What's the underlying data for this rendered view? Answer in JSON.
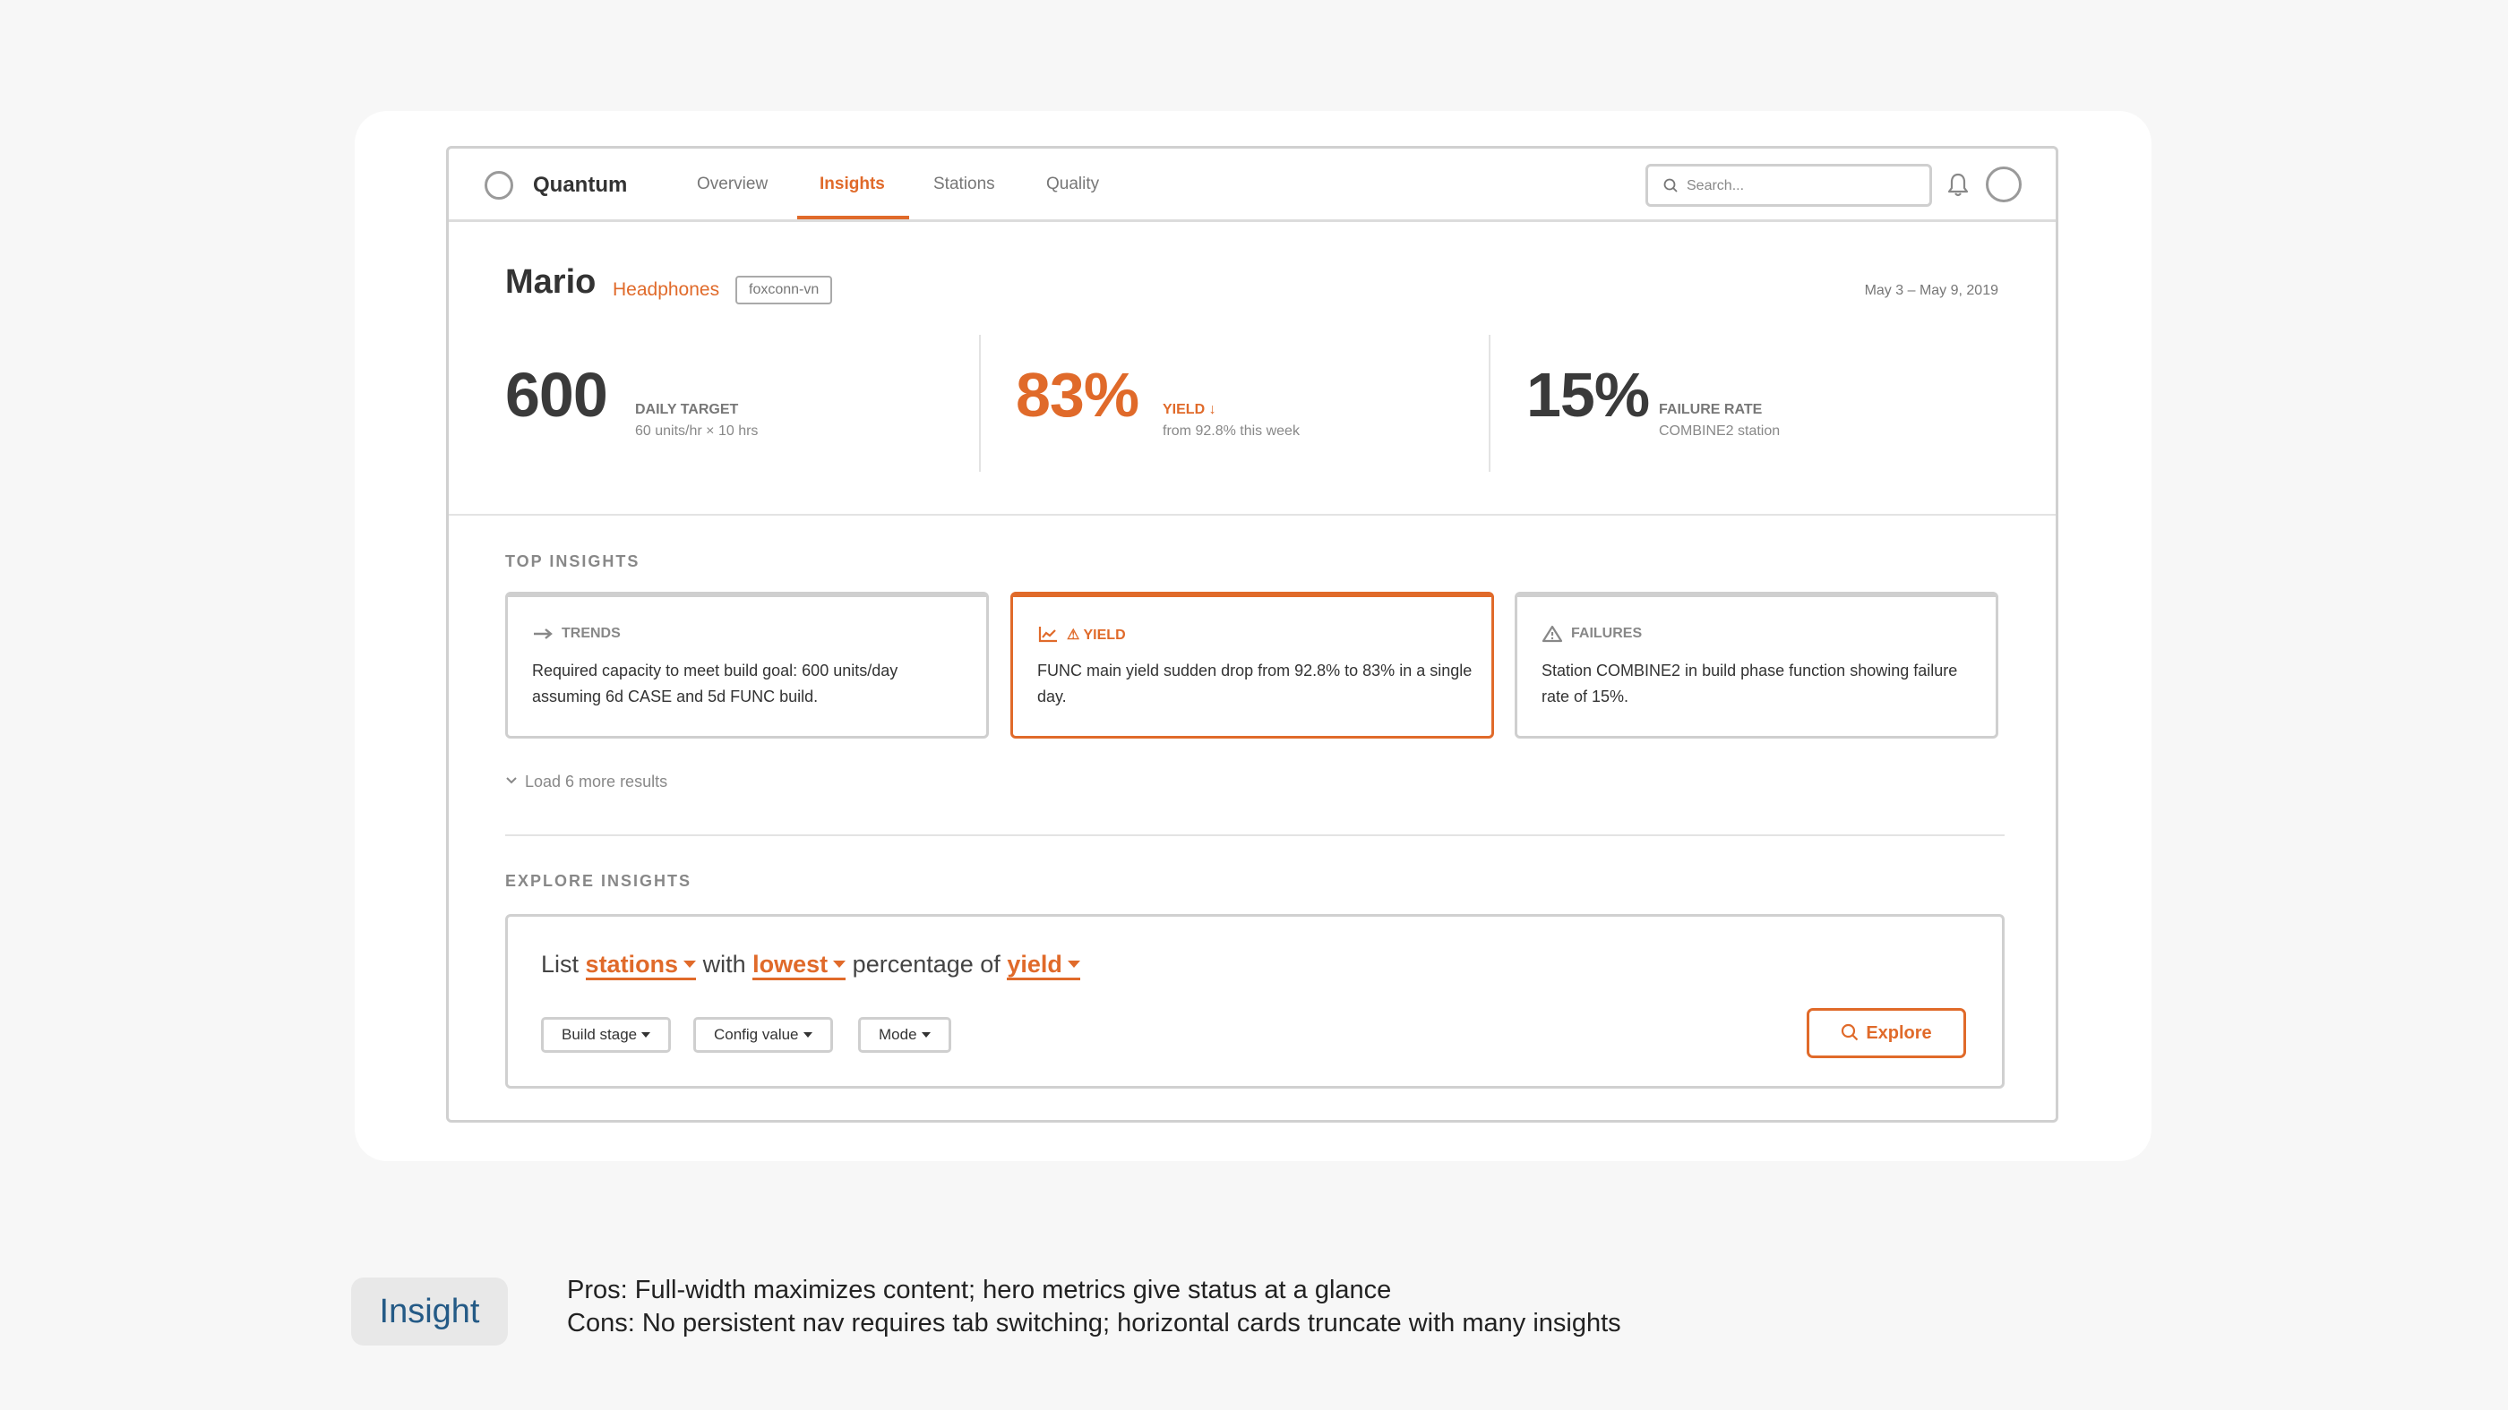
{
  "app": {
    "brand": "Quantum"
  },
  "nav": {
    "tabs": [
      {
        "label": "Overview"
      },
      {
        "label": "Insights"
      },
      {
        "label": "Stations"
      },
      {
        "label": "Quality"
      }
    ],
    "active": "Insights"
  },
  "search": {
    "placeholder": "Search..."
  },
  "header": {
    "title": "Mario",
    "product": "Headphones",
    "tag": "foxconn-vn",
    "date_range": "May 3 – May 9, 2019"
  },
  "metrics": [
    {
      "value": "600",
      "label": "DAILY TARGET",
      "sub": "60 units/hr × 10 hrs"
    },
    {
      "value": "83%",
      "label": "YIELD ↓",
      "sub": "from 92.8% this week"
    },
    {
      "value": "15%",
      "label": "FAILURE RATE",
      "sub": "COMBINE2 station"
    }
  ],
  "top_insights": {
    "title": "TOP INSIGHTS",
    "cards": [
      {
        "icon": "arrow-right-icon",
        "label": "TRENDS",
        "text": "Required capacity to meet build goal: 600 units/day assuming 6d CASE and 5d FUNC build."
      },
      {
        "icon": "line-chart-icon",
        "label": "⚠ YIELD",
        "text": "FUNC main yield sudden drop from 92.8% to 83% in a single day."
      },
      {
        "icon": "warning-triangle-icon",
        "label": "FAILURES",
        "text": "Station COMBINE2 in build phase function showing failure rate of 15%."
      }
    ],
    "load_more": "Load 6 more results"
  },
  "explore": {
    "title": "EXPLORE INSIGHTS",
    "query": {
      "w1": "List",
      "p1": "stations",
      "w2": "with",
      "p2": "lowest",
      "w3": "percentage of",
      "p3": "yield"
    },
    "filters": [
      "Build stage",
      "Config value",
      "Mode"
    ],
    "button": "Explore"
  },
  "caption": {
    "tag": "Insight",
    "pros": "Pros: Full-width maximizes content; hero metrics give status at a glance",
    "cons": "Cons: No persistent nav requires tab switching; horizontal cards truncate with many insights"
  },
  "colors": {
    "accent": "#e06a2a",
    "caption_tag": "#245a86"
  }
}
